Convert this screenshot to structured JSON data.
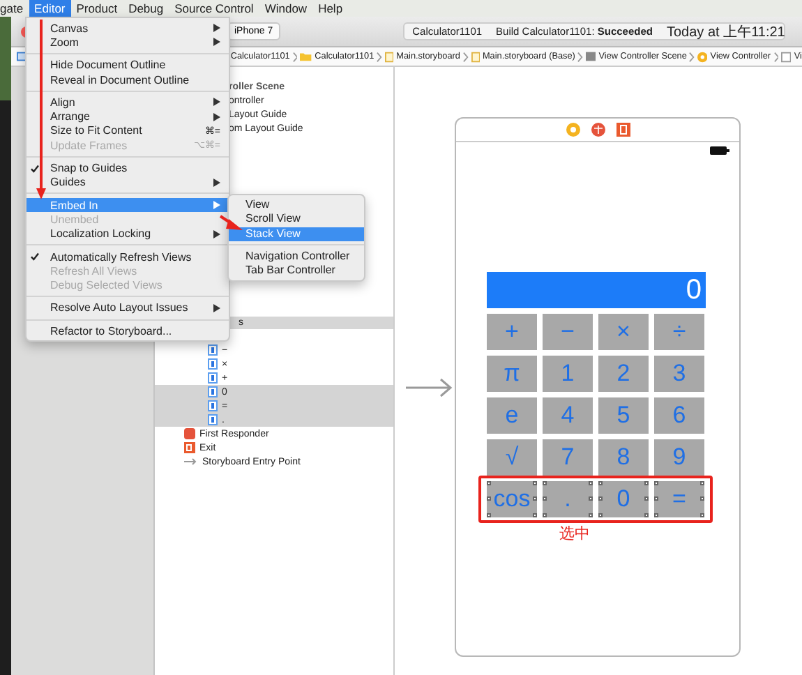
{
  "menubar": [
    {
      "label": "gate",
      "selected": false
    },
    {
      "label": "Editor",
      "selected": true
    },
    {
      "label": "Product",
      "selected": false
    },
    {
      "label": "Debug",
      "selected": false
    },
    {
      "label": "Source Control",
      "selected": false
    },
    {
      "label": "Window",
      "selected": false
    },
    {
      "label": "Help",
      "selected": false
    }
  ],
  "toolbar": {
    "scheme": "iPhone 7",
    "activity": [
      {
        "text": "Calculator1101"
      },
      {
        "text": "Build Calculator1101: **Succeeded**"
      },
      {
        "text": "Today at 上午11:21"
      }
    ]
  },
  "breadcrumb": [
    {
      "label": "Calculator1101",
      "kind": "folder"
    },
    {
      "label": "Calculator1101",
      "kind": "folder"
    },
    {
      "label": "Main.storyboard",
      "kind": "file"
    },
    {
      "label": "Main.storyboard (Base)",
      "kind": "file"
    },
    {
      "label": "View Controller Scene",
      "kind": "scene"
    },
    {
      "label": "View Controller",
      "kind": "controller"
    },
    {
      "label": "Vi",
      "kind": "view"
    }
  ],
  "outline": {
    "scene_rows": [
      {
        "label": "roller Scene",
        "kind": "scene"
      },
      {
        "label": "ontroller",
        "kind": "item"
      },
      {
        "label": "Layout Guide",
        "kind": "item"
      },
      {
        "label": "om Layout Guide",
        "kind": "item"
      }
    ],
    "stack_header": "s",
    "buttons": [
      {
        "label": "−",
        "selected": false
      },
      {
        "label": "×",
        "selected": false
      },
      {
        "label": "+",
        "selected": false
      },
      {
        "label": "0",
        "selected": true
      },
      {
        "label": "=",
        "selected": true
      },
      {
        "label": ".",
        "selected": true
      }
    ],
    "scene_items": [
      {
        "label": "First Responder",
        "kind": "responder"
      },
      {
        "label": "Exit",
        "kind": "exit"
      },
      {
        "label": "Storyboard Entry Point",
        "kind": "entry"
      }
    ]
  },
  "editor_menu": {
    "groups": [
      {
        "items": [
          {
            "label": "Canvas",
            "submenu": true,
            "checked": false,
            "disabled": false,
            "selected": false
          },
          {
            "label": "Zoom",
            "submenu": true,
            "checked": false,
            "disabled": false,
            "selected": false
          }
        ]
      },
      {
        "items": [
          {
            "label": "Hide Document Outline",
            "submenu": false,
            "checked": false,
            "disabled": false,
            "selected": false
          },
          {
            "label": "Reveal in Document Outline",
            "submenu": false,
            "checked": false,
            "disabled": false,
            "selected": false
          }
        ]
      },
      {
        "items": [
          {
            "label": "Align",
            "submenu": true,
            "checked": false,
            "disabled": false,
            "selected": false
          },
          {
            "label": "Arrange",
            "submenu": true,
            "checked": false,
            "disabled": false,
            "selected": false
          },
          {
            "label": "Size to Fit Content",
            "shortcut": "⌘=",
            "submenu": false,
            "checked": false,
            "disabled": false,
            "selected": false
          },
          {
            "label": "Update Frames",
            "shortcut": "⌥⌘=",
            "submenu": false,
            "checked": false,
            "disabled": true,
            "selected": false
          }
        ]
      },
      {
        "items": [
          {
            "label": "Snap to Guides",
            "submenu": false,
            "checked": true,
            "disabled": false,
            "selected": false
          },
          {
            "label": "Guides",
            "submenu": true,
            "checked": false,
            "disabled": false,
            "selected": false
          }
        ]
      },
      {
        "items": [
          {
            "label": "Embed In",
            "submenu": true,
            "checked": false,
            "disabled": false,
            "selected": true
          },
          {
            "label": "Unembed",
            "submenu": false,
            "checked": false,
            "disabled": true,
            "selected": false
          },
          {
            "label": "Localization Locking",
            "submenu": true,
            "checked": false,
            "disabled": false,
            "selected": false
          }
        ]
      },
      {
        "items": [
          {
            "label": "Automatically Refresh Views",
            "submenu": false,
            "checked": true,
            "disabled": false,
            "selected": false
          },
          {
            "label": "Refresh All Views",
            "submenu": false,
            "checked": false,
            "disabled": true,
            "selected": false
          },
          {
            "label": "Debug Selected Views",
            "submenu": false,
            "checked": false,
            "disabled": true,
            "selected": false
          }
        ]
      },
      {
        "items": [
          {
            "label": "Resolve Auto Layout Issues",
            "submenu": true,
            "checked": false,
            "disabled": false,
            "selected": false
          }
        ]
      },
      {
        "items": [
          {
            "label": "Refactor to Storyboard...",
            "submenu": false,
            "checked": false,
            "disabled": false,
            "selected": false
          }
        ]
      }
    ]
  },
  "embed_submenu": {
    "groups": [
      {
        "items": [
          {
            "label": "View",
            "selected": false
          },
          {
            "label": "Scroll View",
            "selected": false
          },
          {
            "label": "Stack View",
            "selected": true
          }
        ]
      },
      {
        "items": [
          {
            "label": "Navigation Controller",
            "selected": false
          },
          {
            "label": "Tab Bar Controller",
            "selected": false
          }
        ]
      }
    ]
  },
  "calculator": {
    "display": "0",
    "annotation": "选中",
    "rows": [
      {
        "boxed": false,
        "keys": [
          {
            "label": "+",
            "selected": false
          },
          {
            "label": "−",
            "selected": false
          },
          {
            "label": "×",
            "selected": false
          },
          {
            "label": "÷",
            "selected": false
          }
        ]
      },
      {
        "boxed": false,
        "keys": [
          {
            "label": "π",
            "selected": false
          },
          {
            "label": "1",
            "selected": false
          },
          {
            "label": "2",
            "selected": false
          },
          {
            "label": "3",
            "selected": false
          }
        ]
      },
      {
        "boxed": false,
        "keys": [
          {
            "label": "e",
            "selected": false
          },
          {
            "label": "4",
            "selected": false
          },
          {
            "label": "5",
            "selected": false
          },
          {
            "label": "6",
            "selected": false
          }
        ]
      },
      {
        "boxed": false,
        "keys": [
          {
            "label": "√",
            "selected": false
          },
          {
            "label": "7",
            "selected": false
          },
          {
            "label": "8",
            "selected": false
          },
          {
            "label": "9",
            "selected": false
          }
        ]
      },
      {
        "boxed": true,
        "keys": [
          {
            "label": "cos",
            "selected": true
          },
          {
            "label": ".",
            "selected": true
          },
          {
            "label": "0",
            "selected": true
          },
          {
            "label": "=",
            "selected": true
          }
        ]
      }
    ]
  }
}
